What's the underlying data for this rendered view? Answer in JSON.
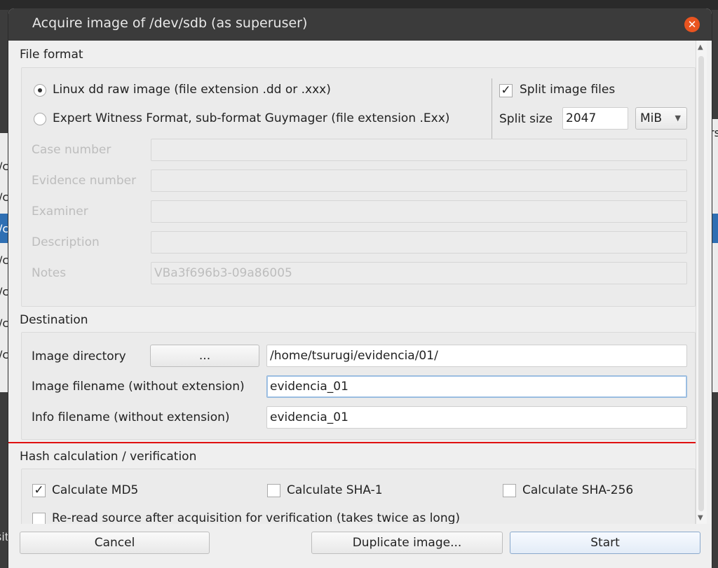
{
  "dialog": {
    "title": "Acquire image of /dev/sdb (as superuser)"
  },
  "file_format": {
    "section_title": "File format",
    "option_dd": "Linux dd raw image (file extension .dd or .xxx)",
    "option_ewf": "Expert Witness Format, sub-format Guymager (file extension .Exx)",
    "selected": "dd",
    "split_label": "Split image files",
    "split_checked": true,
    "split_size_label": "Split size",
    "split_size_value": "2047",
    "split_unit": "MiB",
    "case_number_label": "Case number",
    "evidence_number_label": "Evidence number",
    "examiner_label": "Examiner",
    "description_label": "Description",
    "notes_label": "Notes",
    "notes_value": "VBa3f696b3-09a86005"
  },
  "destination": {
    "section_title": "Destination",
    "image_directory_label": "Image directory",
    "browse_label": "...",
    "image_directory_value": "/home/tsurugi/evidencia/01/",
    "image_filename_label": "Image filename (without extension)",
    "image_filename_value": "evidencia_01",
    "info_filename_label": "Info filename (without extension)",
    "info_filename_value": "evidencia_01"
  },
  "hash": {
    "section_title": "Hash calculation / verification",
    "md5_label": "Calculate MD5",
    "md5_checked": true,
    "sha1_label": "Calculate SHA-1",
    "sha1_checked": false,
    "sha256_label": "Calculate SHA-256",
    "sha256_checked": false,
    "reread_label": "Re-read source after acquisition for verification (takes twice as long)",
    "reread_checked": false
  },
  "buttons": {
    "cancel": "Cancel",
    "duplicate": "Duplicate image...",
    "start": "Start"
  },
  "background": {
    "left_fragments": [
      "/c",
      "/c",
      "/c",
      "/c",
      "/c",
      "/c",
      "/c"
    ],
    "right_fragment": "rs",
    "bottom_fragment": "sit"
  },
  "icons": {
    "close": "close-icon",
    "check": "check-mark",
    "dropdown": "chevron-down-icon",
    "cursor": "mouse-pointer-icon"
  },
  "colors": {
    "title_bar": "#3b3b3b",
    "close_button": "#e95420",
    "highlight_box": "#e01010",
    "selection_blue": "#2f6fb3"
  }
}
